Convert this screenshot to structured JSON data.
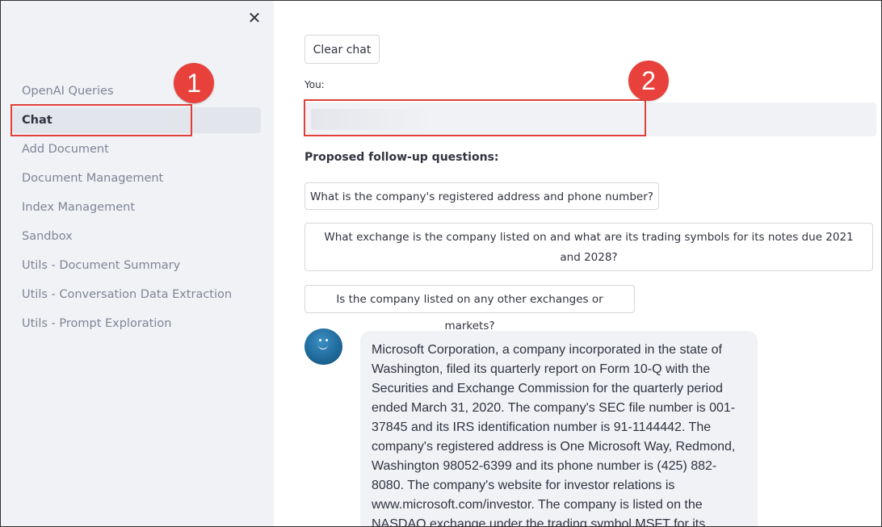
{
  "sidebar": {
    "close_symbol": "✕",
    "items": [
      {
        "label": "OpenAI Queries",
        "active": false
      },
      {
        "label": "Chat",
        "active": true
      },
      {
        "label": "Add Document",
        "active": false
      },
      {
        "label": "Document Management",
        "active": false
      },
      {
        "label": "Index Management",
        "active": false
      },
      {
        "label": "Sandbox",
        "active": false
      },
      {
        "label": "Utils - Document Summary",
        "active": false
      },
      {
        "label": "Utils - Conversation Data Extraction",
        "active": false
      },
      {
        "label": "Utils - Prompt Exploration",
        "active": false
      }
    ]
  },
  "main": {
    "clear_chat_label": "Clear chat",
    "you_label": "You:",
    "input_value": "",
    "followups_title": "Proposed follow-up questions:",
    "followups": [
      "What is the company's registered address and phone number?",
      "What exchange is the company listed on and what are its trading symbols for its notes due 2021 and 2028?",
      "Is the company listed on any other exchanges or markets?"
    ],
    "bot_message": "Microsoft Corporation, a company incorporated in the state of Washington, filed its quarterly report on Form 10-Q with the Securities and Exchange Commission for the quarterly period ended March 31, 2020. The company's SEC file number is 001-37845 and its IRS identification number is 91-1144442. The company's registered address is One Microsoft Way, Redmond, Washington 98052-6399 and its phone number is (425) 882-8080. The company's website for investor relations is www.microsoft.com/investor. The company is listed on the NASDAQ exchange under the trading symbol MSFT for its"
  },
  "annotations": {
    "badge_1": "1",
    "badge_2": "2",
    "color": "#e8413b"
  },
  "colors": {
    "sidebar_bg": "#f0f2f6",
    "text": "#31333f",
    "muted_text": "#808495",
    "avatar": "#1f6b9c"
  }
}
